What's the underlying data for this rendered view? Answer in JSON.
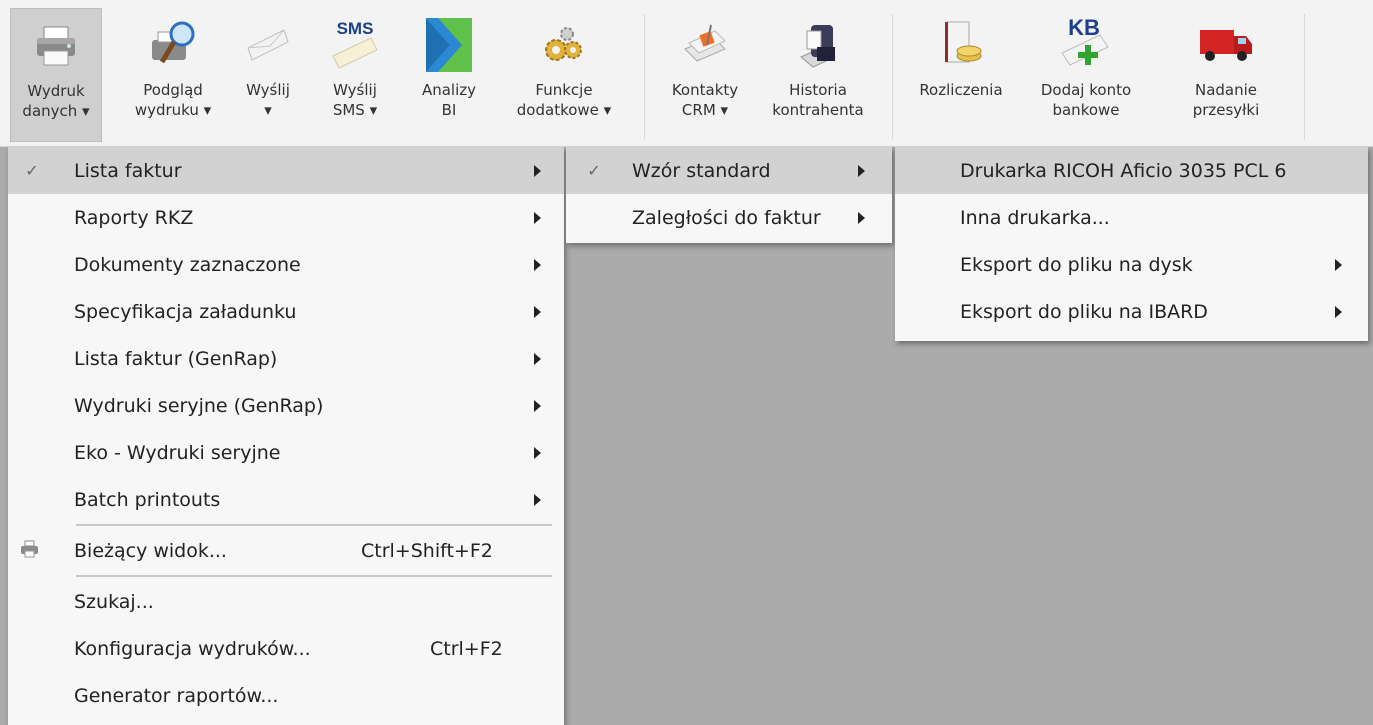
{
  "ribbon": {
    "buttons": [
      {
        "line1": "Wydruk",
        "line2": "danych ▾",
        "icon": "printer-icon"
      },
      {
        "line1": "Podgląd",
        "line2": "wydruku ▾",
        "icon": "print-preview-icon"
      },
      {
        "line1": "Wyślij",
        "line2": "▾",
        "icon": "send-envelope-icon"
      },
      {
        "line1": "Wyślij",
        "line2": "SMS ▾",
        "icon": "sms-icon",
        "icon_text": "SMS"
      },
      {
        "line1": "Analizy",
        "line2": "BI",
        "icon": "bi-chevron-icon"
      },
      {
        "line1": "Funkcje",
        "line2": "dodatkowe ▾",
        "icon": "gears-icon"
      },
      {
        "line1": "Kontakty",
        "line2": "CRM ▾",
        "icon": "crm-contacts-icon"
      },
      {
        "line1": "Historia",
        "line2": "kontrahenta",
        "icon": "contractor-history-icon"
      },
      {
        "line1": "Rozliczenia",
        "line2": "",
        "icon": "settlements-icon"
      },
      {
        "line1": "Dodaj konto",
        "line2": "bankowe",
        "icon": "add-bank-account-icon",
        "icon_text": "KB"
      },
      {
        "line1": "Nadanie",
        "line2": "przesyłki",
        "icon": "delivery-truck-icon"
      }
    ]
  },
  "menu1": {
    "items": [
      {
        "label": "Lista faktur",
        "checked": "✓",
        "submenu": true
      },
      {
        "label": "Raporty RKZ",
        "submenu": true
      },
      {
        "label": "Dokumenty zaznaczone",
        "submenu": true
      },
      {
        "label": "Specyfikacja załadunku",
        "submenu": true
      },
      {
        "label": "Lista faktur (GenRap)",
        "submenu": true
      },
      {
        "label": "Wydruki seryjne (GenRap)",
        "submenu": true
      },
      {
        "label": "Eko - Wydruki seryjne",
        "submenu": true
      },
      {
        "label": "Batch printouts",
        "submenu": true
      }
    ],
    "current_view": {
      "label": "Bieżący widok...",
      "shortcut": "Ctrl+Shift+F2"
    },
    "tail_items": [
      {
        "label": "Szukaj..."
      },
      {
        "label": "Konfiguracja wydruków...",
        "shortcut": "Ctrl+F2"
      },
      {
        "label": "Generator raportów..."
      }
    ]
  },
  "menu2": {
    "items": [
      {
        "label": "Wzór standard",
        "checked": "✓"
      },
      {
        "label": "Zaległości do faktur"
      }
    ]
  },
  "menu3": {
    "items": [
      {
        "label": "Drukarka RICOH Aficio 3035 PCL 6"
      },
      {
        "label": "Inna drukarka..."
      },
      {
        "label": "Eksport do pliku na dysk"
      },
      {
        "label": "Eksport do pliku na IBARD"
      }
    ]
  },
  "colors": {
    "highlight": "#d2d2d2",
    "menu_bg": "#f7f7f7",
    "desktop_bg": "#ababab",
    "bi_green": "#5fc04a",
    "bi_blue": "#1f6fb5",
    "truck_red": "#d42424",
    "bank_plus_green": "#2fa52f"
  }
}
